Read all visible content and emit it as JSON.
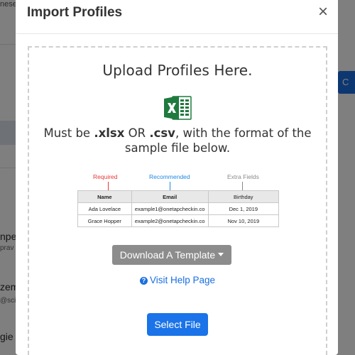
{
  "background": {
    "fragments": [
      "nese",
      "npe",
      "prav",
      "zem",
      "@sci",
      "gie"
    ],
    "button_label": "C"
  },
  "modal": {
    "title": "Import Profiles",
    "close_label": "×"
  },
  "upload": {
    "heading": "Upload Profiles Here.",
    "requirement": {
      "prefix": "Must be ",
      "ext1": ".xlsx",
      "or": " OR ",
      "ext2": ".csv",
      "suffix_line1": ", with the format of the",
      "line2": "sample file below."
    }
  },
  "sample": {
    "labels": {
      "required": "Required",
      "recommended": "Recommended",
      "extra": "Extra Fields"
    },
    "columns": [
      "Name",
      "Email",
      "Birthday"
    ],
    "rows": [
      [
        "Ada Lovelace",
        "example1@onetapcheckin.co",
        "Dec 1, 2019"
      ],
      [
        "Grace Hopper",
        "example2@onetapcheckin.co",
        "Nov 10, 2019"
      ]
    ]
  },
  "actions": {
    "download_label": "Download A Template",
    "help_label": "Visit Help Page",
    "help_icon": "?",
    "select_label": "Select File"
  },
  "colors": {
    "accent": "#1a73e8",
    "required": "#e53935",
    "recommended": "#1e88e5",
    "excel_green": "#1f7a3e"
  }
}
